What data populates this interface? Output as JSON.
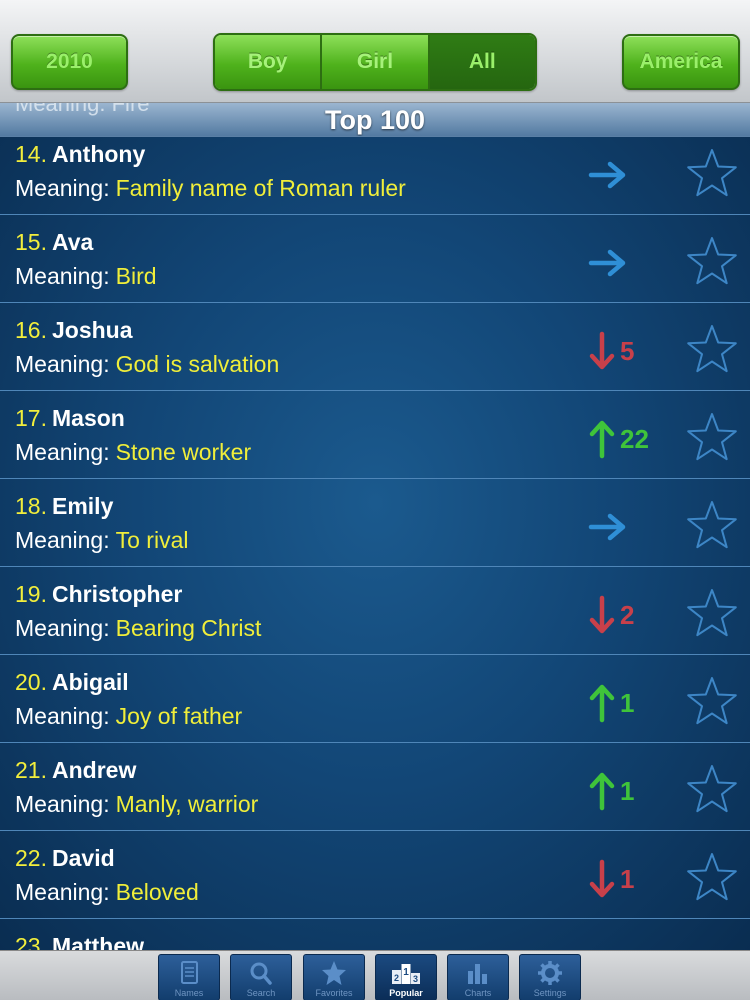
{
  "toolbar": {
    "year_label": "2010",
    "segments": [
      {
        "label": "Boy",
        "active": false
      },
      {
        "label": "Girl",
        "active": false
      },
      {
        "label": "All",
        "active": true
      }
    ],
    "country_label": "America",
    "accent_color": "#4fb21c"
  },
  "section": {
    "peek_text": "Meaning: Fire",
    "title": "Top 100"
  },
  "rows": [
    {
      "rank": "14.",
      "name": "Anthony",
      "meaning_label": "Meaning:",
      "meaning": "Family name of Roman ruler",
      "trend": "same",
      "change": ""
    },
    {
      "rank": "15.",
      "name": "Ava",
      "meaning_label": "Meaning:",
      "meaning": "Bird",
      "trend": "same",
      "change": ""
    },
    {
      "rank": "16.",
      "name": "Joshua",
      "meaning_label": "Meaning:",
      "meaning": "God is salvation",
      "trend": "down",
      "change": "5"
    },
    {
      "rank": "17.",
      "name": "Mason",
      "meaning_label": "Meaning:",
      "meaning": "Stone worker",
      "trend": "up",
      "change": "22"
    },
    {
      "rank": "18.",
      "name": "Emily",
      "meaning_label": "Meaning:",
      "meaning": "To rival",
      "trend": "same",
      "change": ""
    },
    {
      "rank": "19.",
      "name": "Christopher",
      "meaning_label": "Meaning:",
      "meaning": "Bearing Christ",
      "trend": "down",
      "change": "2"
    },
    {
      "rank": "20.",
      "name": "Abigail",
      "meaning_label": "Meaning:",
      "meaning": "Joy of father",
      "trend": "up",
      "change": "1"
    },
    {
      "rank": "21.",
      "name": "Andrew",
      "meaning_label": "Meaning:",
      "meaning": "Manly, warrior",
      "trend": "up",
      "change": "1"
    },
    {
      "rank": "22.",
      "name": "David",
      "meaning_label": "Meaning:",
      "meaning": "Beloved",
      "trend": "down",
      "change": "1"
    },
    {
      "rank": "23.",
      "name": "Matthew",
      "meaning_label": "",
      "meaning": "",
      "trend": "",
      "change": ""
    }
  ],
  "tabbar": {
    "tabs": [
      {
        "label": "Names",
        "icon": "notebook-icon",
        "active": false
      },
      {
        "label": "Search",
        "icon": "search-icon",
        "active": false
      },
      {
        "label": "Favorites",
        "icon": "star-icon",
        "active": false
      },
      {
        "label": "Popular",
        "icon": "podium-icon",
        "active": true
      },
      {
        "label": "Charts",
        "icon": "bar-chart-icon",
        "active": false
      },
      {
        "label": "Settings",
        "icon": "gear-icon",
        "active": false
      }
    ]
  },
  "colors": {
    "rank": "#f2ee3c",
    "meaning_value": "#f0ee3a",
    "trend_same": "#2f8fd6",
    "trend_up": "#3fc43a",
    "trend_down": "#c8404a",
    "star_outline": "#3d86c6"
  }
}
